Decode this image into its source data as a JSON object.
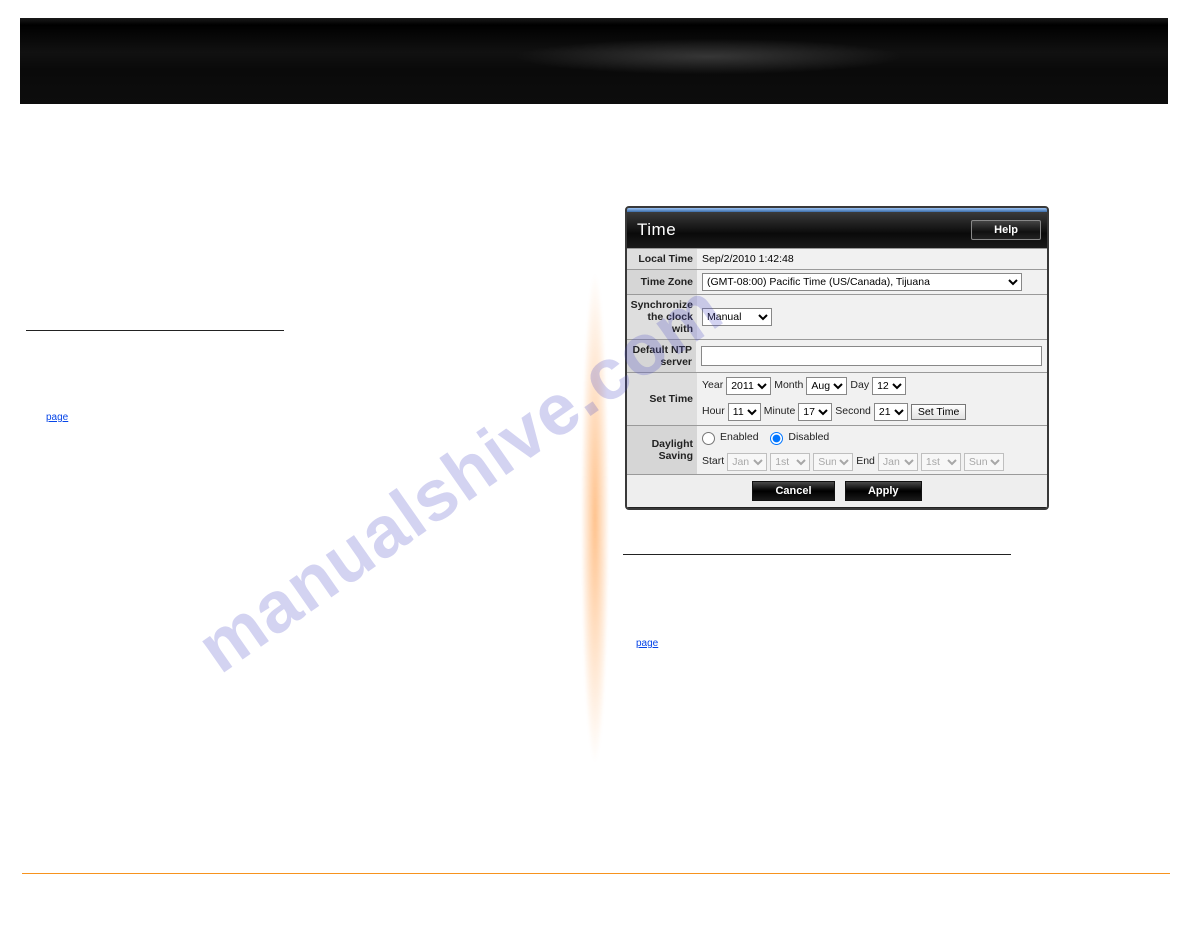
{
  "watermark": "manualshive.com",
  "panel": {
    "title": "Time",
    "help_label": "Help",
    "rows": {
      "local_time": {
        "label": "Local Time",
        "value": "Sep/2/2010 1:42:48"
      },
      "time_zone": {
        "label": "Time Zone",
        "value": "(GMT-08:00) Pacific Time (US/Canada), Tijuana"
      },
      "sync": {
        "label": "Synchronize the clock with",
        "value": "Manual"
      },
      "ntp": {
        "label": "Default NTP server",
        "value": ""
      },
      "set_time": {
        "label": "Set Time",
        "year_label": "Year",
        "year_value": "2011",
        "month_label": "Month",
        "month_value": "Aug",
        "day_label": "Day",
        "day_value": "12",
        "hour_label": "Hour",
        "hour_value": "11",
        "minute_label": "Minute",
        "minute_value": "17",
        "second_label": "Second",
        "second_value": "21",
        "button": "Set Time"
      },
      "dst": {
        "label": "Daylight Saving",
        "enabled_label": "Enabled",
        "disabled_label": "Disabled",
        "selected": "disabled",
        "start_label": "Start",
        "end_label": "End",
        "start_month": "Jan",
        "start_week": "1st",
        "start_day": "Sun",
        "end_month": "Jan",
        "end_week": "1st",
        "end_day": "Sun"
      }
    },
    "footer": {
      "cancel": "Cancel",
      "apply": "Apply"
    }
  },
  "links": {
    "left_page": "page",
    "right_page": "page"
  }
}
